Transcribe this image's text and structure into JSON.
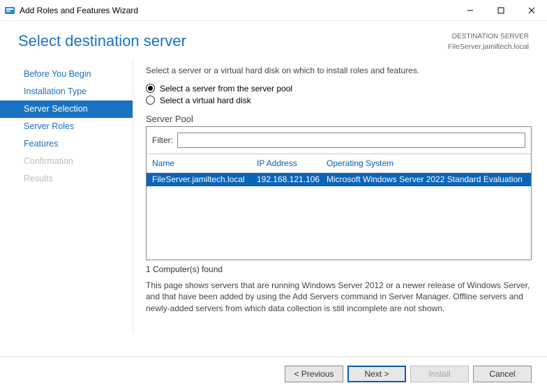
{
  "titlebar": {
    "title": "Add Roles and Features Wizard"
  },
  "header": {
    "title": "Select destination server",
    "dest_label": "DESTINATION SERVER",
    "dest_value": "FileServer.jamiltech.local"
  },
  "sidebar": {
    "items": [
      {
        "label": "Before You Begin",
        "state": "normal"
      },
      {
        "label": "Installation Type",
        "state": "normal"
      },
      {
        "label": "Server Selection",
        "state": "active"
      },
      {
        "label": "Server Roles",
        "state": "normal"
      },
      {
        "label": "Features",
        "state": "normal"
      },
      {
        "label": "Confirmation",
        "state": "disabled"
      },
      {
        "label": "Results",
        "state": "disabled"
      }
    ]
  },
  "content": {
    "intro": "Select a server or a virtual hard disk on which to install roles and features.",
    "radio1": "Select a server from the server pool",
    "radio2": "Select a virtual hard disk",
    "pool_title": "Server Pool",
    "filter_label": "Filter:",
    "filter_value": "",
    "columns": {
      "name": "Name",
      "ip": "IP Address",
      "os": "Operating System"
    },
    "rows": [
      {
        "name": "FileServer.jamiltech.local",
        "ip": "192.168.121.106",
        "os": "Microsoft Windows Server 2022 Standard Evaluation"
      }
    ],
    "found": "1 Computer(s) found",
    "explain": "This page shows servers that are running Windows Server 2012 or a newer release of Windows Server, and that have been added by using the Add Servers command in Server Manager. Offline servers and newly-added servers from which data collection is still incomplete are not shown."
  },
  "footer": {
    "previous": "< Previous",
    "next": "Next >",
    "install": "Install",
    "cancel": "Cancel"
  }
}
